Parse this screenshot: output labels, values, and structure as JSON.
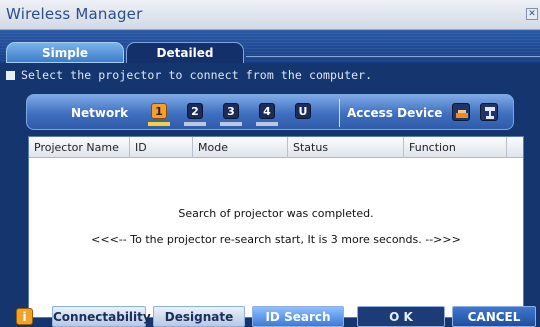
{
  "window": {
    "title": "Wireless Manager"
  },
  "tabs": [
    {
      "label": "Simple"
    },
    {
      "label": "Detailed"
    }
  ],
  "instruction": "Select the projector to connect from the computer.",
  "network": {
    "label": "Network",
    "buttons": [
      "1",
      "2",
      "3",
      "4",
      "U"
    ],
    "selected": "1",
    "access_device_label": "Access Device"
  },
  "table": {
    "columns": [
      "Projector Name",
      "ID",
      "Mode",
      "Status",
      "Function"
    ],
    "message": "Search of projector was completed.",
    "countdown": "<<<-- To the projector re-search start, It is 3 more seconds. -->>>"
  },
  "buttons": {
    "connectability": "Connectability",
    "designate": "Designate",
    "id_search": "ID Search",
    "ok": "O K",
    "cancel": "CANCEL"
  },
  "icons": {
    "close": "close-icon",
    "info": "info-icon"
  }
}
